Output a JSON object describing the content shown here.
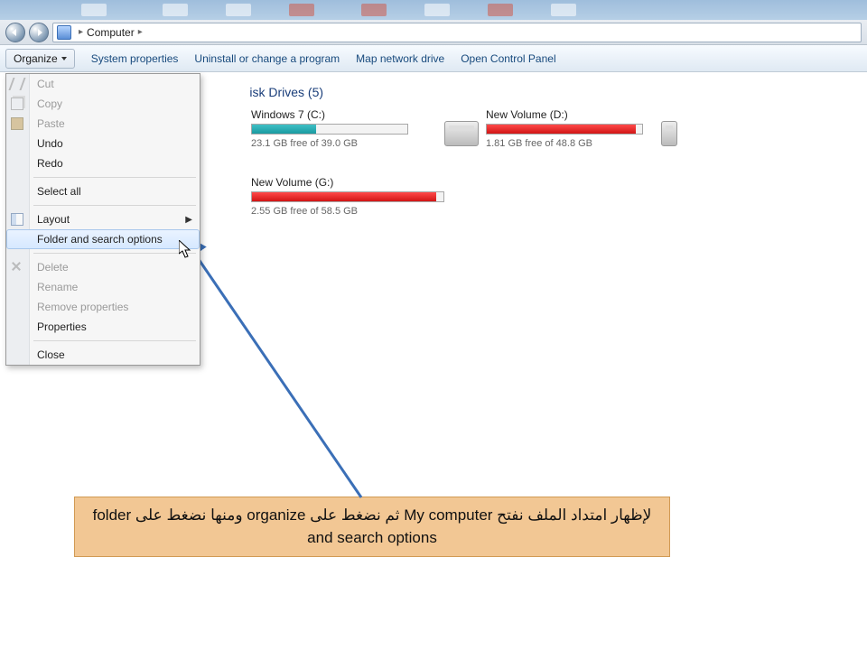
{
  "titlebar": {},
  "nav": {
    "crumb_root": "Computer"
  },
  "toolbar": {
    "organize": "Organize",
    "system_properties": "System properties",
    "uninstall": "Uninstall or change a program",
    "map_drive": "Map network drive",
    "control_panel": "Open Control Panel"
  },
  "section_title_suffix": "isk Drives (5)",
  "drives": {
    "c": {
      "name": "Windows 7 (C:)",
      "free": "23.1 GB free of 39.0 GB",
      "fill_pct": 41,
      "color": "teal"
    },
    "d": {
      "name": "New Volume (D:)",
      "free": "1.81 GB free of 48.8 GB",
      "fill_pct": 96,
      "color": "red"
    },
    "g": {
      "name": "New Volume (G:)",
      "free": "2.55 GB free of 58.5 GB",
      "fill_pct": 96,
      "color": "red"
    }
  },
  "menu": {
    "cut": "Cut",
    "copy": "Copy",
    "paste": "Paste",
    "undo": "Undo",
    "redo": "Redo",
    "select_all": "Select all",
    "layout": "Layout",
    "folder_options": "Folder and search options",
    "delete": "Delete",
    "rename": "Rename",
    "remove_props": "Remove properties",
    "properties": "Properties",
    "close": "Close"
  },
  "callout_text": "لإظهار امتداد الملف نفتح My computer ثم نضغط على organize ومنها نضغط على folder and search options"
}
